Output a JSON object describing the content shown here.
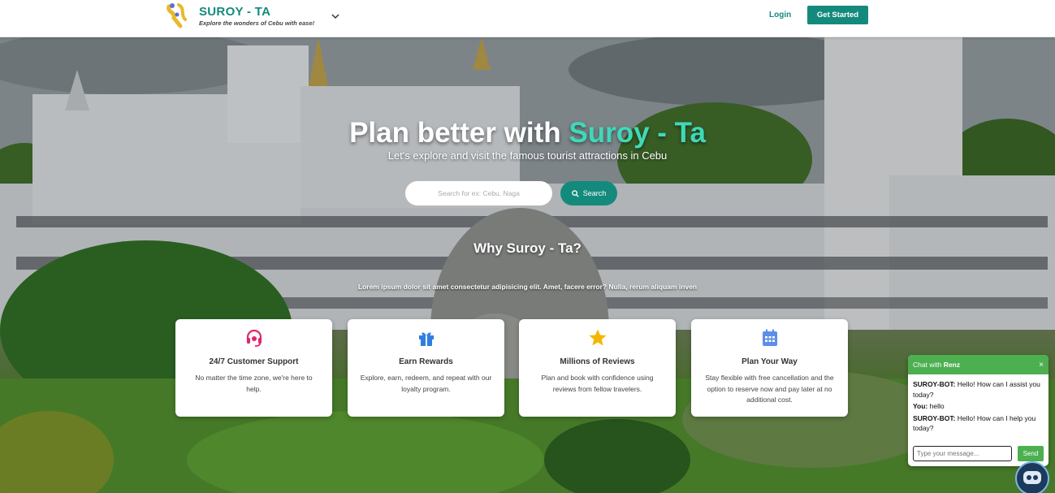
{
  "header": {
    "brand_title": "SUROY - TA",
    "brand_tagline": "Explore the wonders of Cebu with ease!",
    "login_label": "Login",
    "get_started_label": "Get Started"
  },
  "hero": {
    "title_main": "Plan better with ",
    "title_accent": "Suroy - Ta",
    "subtitle": "Let's explore and visit the famous tourist attractions in Cebu",
    "search_placeholder": "Search for ex: Cebu, Naga",
    "search_button_label": "Search"
  },
  "why": {
    "title": "Why Suroy - Ta?",
    "subtitle": "Lorem ipsum dolor sit amet consectetur adipisicing elit. Amet, facere error? Nulla, rerum aliquam inven"
  },
  "features": [
    {
      "icon": "headset-icon",
      "title": "24/7 Customer Support",
      "text": "No matter the time zone, we're here to help."
    },
    {
      "icon": "gift-icon",
      "title": "Earn Rewards",
      "text": "Explore, earn, redeem, and repeat with our loyalty program."
    },
    {
      "icon": "star-icon",
      "title": "Millions of Reviews",
      "text": "Plan and book with confidence using reviews from fellow travelers."
    },
    {
      "icon": "calendar-icon",
      "title": "Plan Your Way",
      "text": "Stay flexible with free cancellation and the option to reserve now and pay later at no additional cost."
    }
  ],
  "chat": {
    "header_prefix": "Chat with ",
    "header_name": "Renz",
    "close_label": "×",
    "messages": [
      {
        "sender": "SUROY-BOT:",
        "text": " Hello! How can I assist you today?"
      },
      {
        "sender": "You:",
        "text": " hello"
      },
      {
        "sender": "SUROY-BOT:",
        "text": " Hello! How can I help you today?"
      }
    ],
    "input_placeholder": "Type your message...",
    "send_label": "Send"
  },
  "colors": {
    "brand": "#148a7d",
    "accent_text": "#3fd9b9",
    "chat_green": "#4caf50",
    "headset_icon": "#e0266f",
    "gift_icon": "#2f7fe0",
    "star_icon": "#f2b800",
    "calendar_icon": "#5d8fe8"
  }
}
